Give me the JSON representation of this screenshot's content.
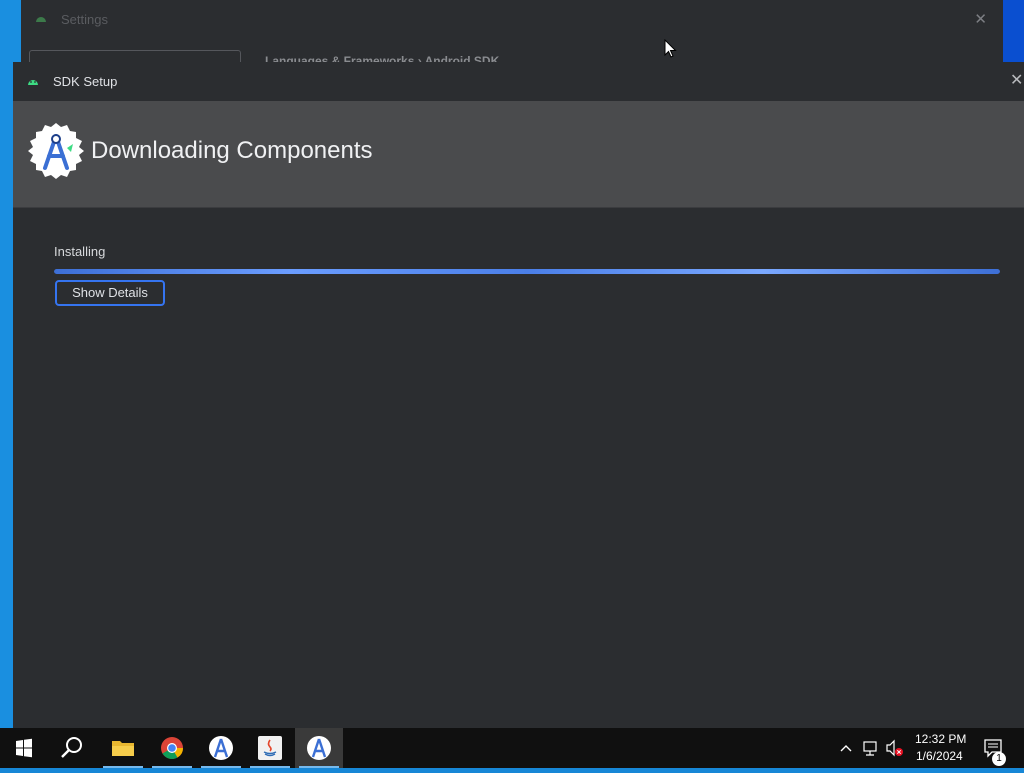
{
  "settings_window": {
    "title": "Settings",
    "breadcrumb": "Languages & Frameworks  ›  Android SDK"
  },
  "dialog": {
    "title": "SDK Setup",
    "heading": "Downloading Components",
    "status": "Installing",
    "progress_fraction": 1.0,
    "show_details_label": "Show Details"
  },
  "taskbar": {
    "items": [
      "start-icon",
      "search-icon",
      "file-explorer-icon",
      "chrome-icon",
      "android-studio-icon",
      "java-icon",
      "android-studio-icon"
    ],
    "clock_time": "12:32 PM",
    "clock_date": "1/6/2024",
    "notification_count": "1"
  },
  "colors": {
    "accent": "#3574f0",
    "dialog_bg": "#2b2d30",
    "header_bg": "#4a4b4d"
  }
}
